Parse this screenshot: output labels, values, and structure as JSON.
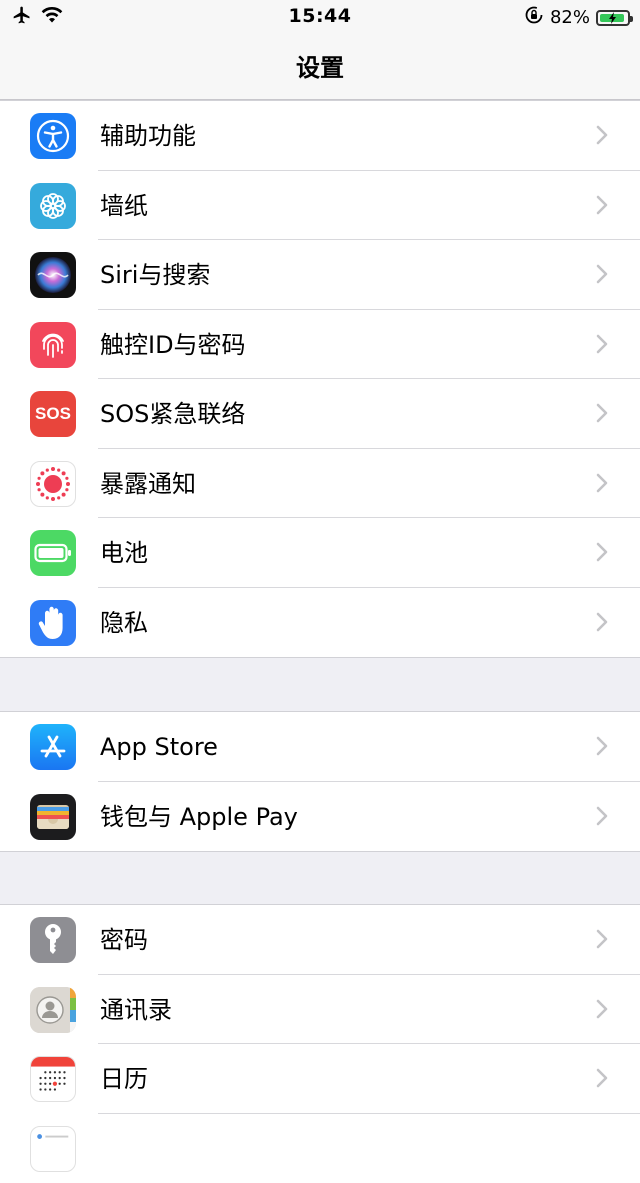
{
  "status_bar": {
    "time": "15:44",
    "battery_percent": "82%"
  },
  "nav": {
    "title": "设置"
  },
  "groups": [
    {
      "items": [
        {
          "label": "辅助功能",
          "icon": "accessibility-icon"
        },
        {
          "label": "墙纸",
          "icon": "wallpaper-icon"
        },
        {
          "label": "Siri与搜索",
          "icon": "siri-icon"
        },
        {
          "label": "触控ID与密码",
          "icon": "fingerprint-icon"
        },
        {
          "label": "SOS紧急联络",
          "icon": "sos-icon",
          "icon_text": "SOS"
        },
        {
          "label": "暴露通知",
          "icon": "exposure-notification-icon"
        },
        {
          "label": "电池",
          "icon": "battery-icon"
        },
        {
          "label": "隐私",
          "icon": "privacy-hand-icon"
        }
      ]
    },
    {
      "items": [
        {
          "label": "App Store",
          "icon": "app-store-icon"
        },
        {
          "label": "钱包与 Apple Pay",
          "icon": "wallet-icon"
        }
      ]
    },
    {
      "items": [
        {
          "label": "密码",
          "icon": "key-icon"
        },
        {
          "label": "通讯录",
          "icon": "contacts-icon"
        },
        {
          "label": "日历",
          "icon": "calendar-icon"
        },
        {
          "label": "",
          "icon": "notes-icon"
        }
      ]
    }
  ],
  "colors": {
    "accessibility": "#1a7cf5",
    "wallpaper": "#35aadc",
    "touch_id": "#f2475b",
    "sos": "#e8453c",
    "battery": "#4cd964",
    "privacy": "#2f7cf6",
    "app_store": "#1a8cf7",
    "wallet": "#1c1c1e",
    "passwords": "#8e8e93"
  }
}
